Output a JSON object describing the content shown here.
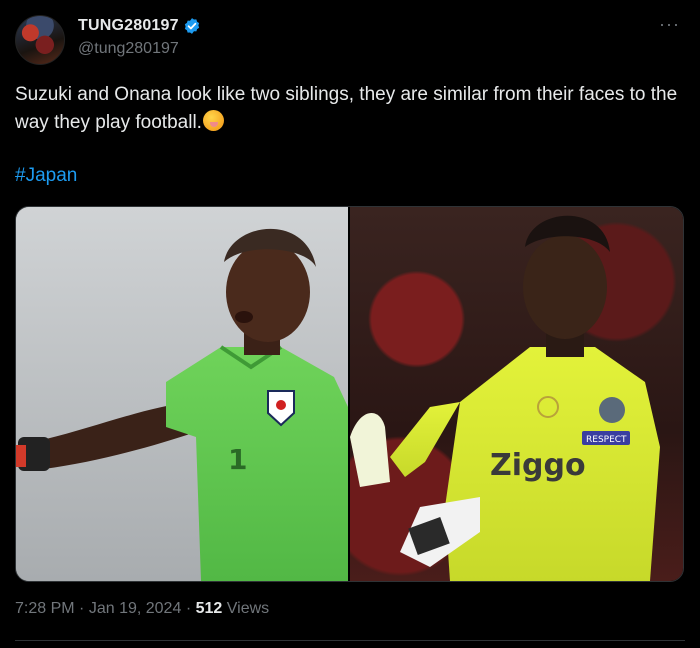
{
  "tweet": {
    "author": {
      "display_name": "TUNG280197",
      "handle": "@tung280197",
      "verified": true
    },
    "more_icon": "ellipsis-icon",
    "text": "Suzuki and Onana look like two siblings, they are similar from their faces to the way they play football.",
    "emoji": "face-with-hand-over-mouth",
    "hashtag": "#Japan",
    "media": [
      {
        "description_icon": "photo-suzuki",
        "jersey_number": "1"
      },
      {
        "description_icon": "photo-onana",
        "sponsor": "Ziggo",
        "badge": "RESPECT"
      }
    ],
    "time": "7:28 PM",
    "date": "Jan 19, 2024",
    "views_count": "512",
    "views_label": "Views",
    "separator": "·"
  },
  "colors": {
    "background": "#000000",
    "text": "#e7e9ea",
    "muted": "#71767b",
    "link": "#1d9bf0",
    "verified": "#1d9bf0"
  }
}
